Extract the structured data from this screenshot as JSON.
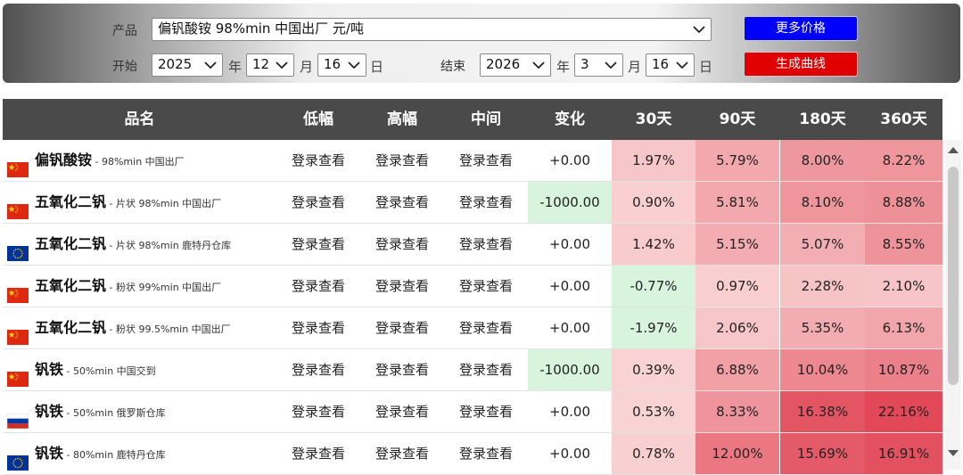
{
  "filter": {
    "product_label": "产品",
    "product_value": "偏钒酸铵 98%min 中国出厂 元/吨",
    "start_label": "开始",
    "end_label": "结束",
    "start": {
      "year": "2025",
      "month": "12",
      "day": "16"
    },
    "end": {
      "year": "2026",
      "month": "3",
      "day": "16"
    },
    "year_unit": "年",
    "month_unit": "月",
    "day_unit": "日",
    "more_prices_label": "更多价格",
    "generate_curve_label": "生成曲线"
  },
  "colors": {
    "more_prices_bg": "#0000ff",
    "generate_curve_bg": "#e00000",
    "header_bg": "#4a4a4a"
  },
  "table": {
    "headers": [
      "品名",
      "低幅",
      "高幅",
      "中间",
      "变化",
      "30天",
      "90天",
      "180天",
      "360天"
    ],
    "rows": [
      {
        "flag": "cn",
        "name": "偏钒酸铵",
        "desc": "98%min 中国出厂",
        "low": "登录查看",
        "high": "登录查看",
        "mid": "登录查看",
        "change": "+0.00",
        "d30": "1.97%",
        "d90": "5.79%",
        "d180": "8.00%",
        "d360": "8.22%"
      },
      {
        "flag": "cn",
        "name": "五氧化二钒",
        "desc": "片状 98%min 中国出厂",
        "low": "登录查看",
        "high": "登录查看",
        "mid": "登录查看",
        "change": "-1000.00",
        "d30": "0.90%",
        "d90": "5.81%",
        "d180": "8.10%",
        "d360": "8.88%"
      },
      {
        "flag": "eu",
        "name": "五氧化二钒",
        "desc": "片状 98%min 鹿特丹仓库",
        "low": "登录查看",
        "high": "登录查看",
        "mid": "登录查看",
        "change": "+0.00",
        "d30": "1.42%",
        "d90": "5.15%",
        "d180": "5.07%",
        "d360": "8.55%"
      },
      {
        "flag": "cn",
        "name": "五氧化二钒",
        "desc": "粉状 99%min 中国出厂",
        "low": "登录查看",
        "high": "登录查看",
        "mid": "登录查看",
        "change": "+0.00",
        "d30": "-0.77%",
        "d90": "0.97%",
        "d180": "2.28%",
        "d360": "2.10%"
      },
      {
        "flag": "cn",
        "name": "五氧化二钒",
        "desc": "粉状 99.5%min 中国出厂",
        "low": "登录查看",
        "high": "登录查看",
        "mid": "登录查看",
        "change": "+0.00",
        "d30": "-1.97%",
        "d90": "2.06%",
        "d180": "5.35%",
        "d360": "6.13%"
      },
      {
        "flag": "cn",
        "name": "钒铁",
        "desc": "50%min 中国交到",
        "low": "登录查看",
        "high": "登录查看",
        "mid": "登录查看",
        "change": "-1000.00",
        "d30": "0.39%",
        "d90": "6.88%",
        "d180": "10.04%",
        "d360": "10.87%"
      },
      {
        "flag": "ru",
        "name": "钒铁",
        "desc": "50%min 俄罗斯仓库",
        "low": "登录查看",
        "high": "登录查看",
        "mid": "登录查看",
        "change": "+0.00",
        "d30": "0.53%",
        "d90": "8.33%",
        "d180": "16.38%",
        "d360": "22.16%"
      },
      {
        "flag": "eu",
        "name": "钒铁",
        "desc": "80%min 鹿特丹仓库",
        "low": "登录查看",
        "high": "登录查看",
        "mid": "登录查看",
        "change": "+0.00",
        "d30": "0.78%",
        "d90": "12.00%",
        "d180": "15.69%",
        "d360": "16.91%"
      }
    ]
  }
}
